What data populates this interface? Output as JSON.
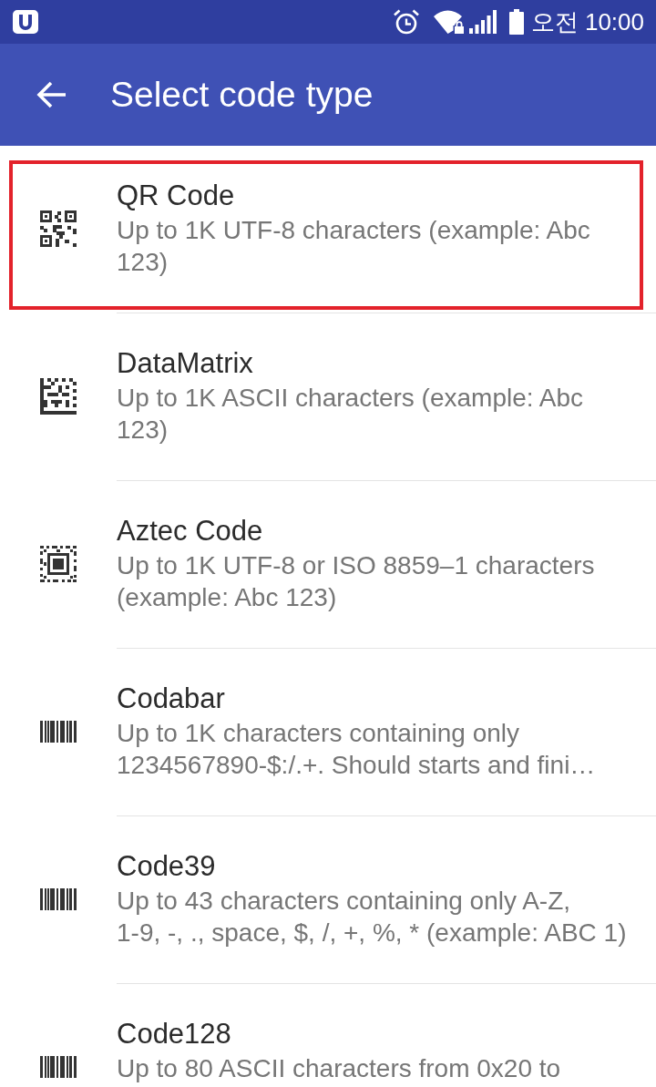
{
  "status_bar": {
    "time": "오전 10:00"
  },
  "app_bar": {
    "title": "Select code type"
  },
  "items": [
    {
      "kind": "qr",
      "title": "QR Code",
      "description": "Up to 1K UTF-8 characters (example: Abc\n123)",
      "highlighted": true
    },
    {
      "kind": "datamatrix",
      "title": "DataMatrix",
      "description": "Up to 1K ASCII characters (example: Abc\n123)",
      "highlighted": false
    },
    {
      "kind": "aztec",
      "title": "Aztec Code",
      "description": "Up to 1K UTF-8 or ISO 8859–1 characters\n(example: Abc 123)",
      "highlighted": false
    },
    {
      "kind": "barcode",
      "title": "Codabar",
      "description": "Up to 1K characters containing only\n1234567890-$:/.+. Should starts and fini…",
      "highlighted": false
    },
    {
      "kind": "barcode",
      "title": "Code39",
      "description": "Up to 43 characters containing only A-Z,\n1-9, -, ., space, $, /, +, %, * (example: ABC 1)",
      "highlighted": false
    },
    {
      "kind": "barcode",
      "title": "Code128",
      "description": "Up to 80 ASCII characters from 0x20 to",
      "highlighted": false
    }
  ]
}
